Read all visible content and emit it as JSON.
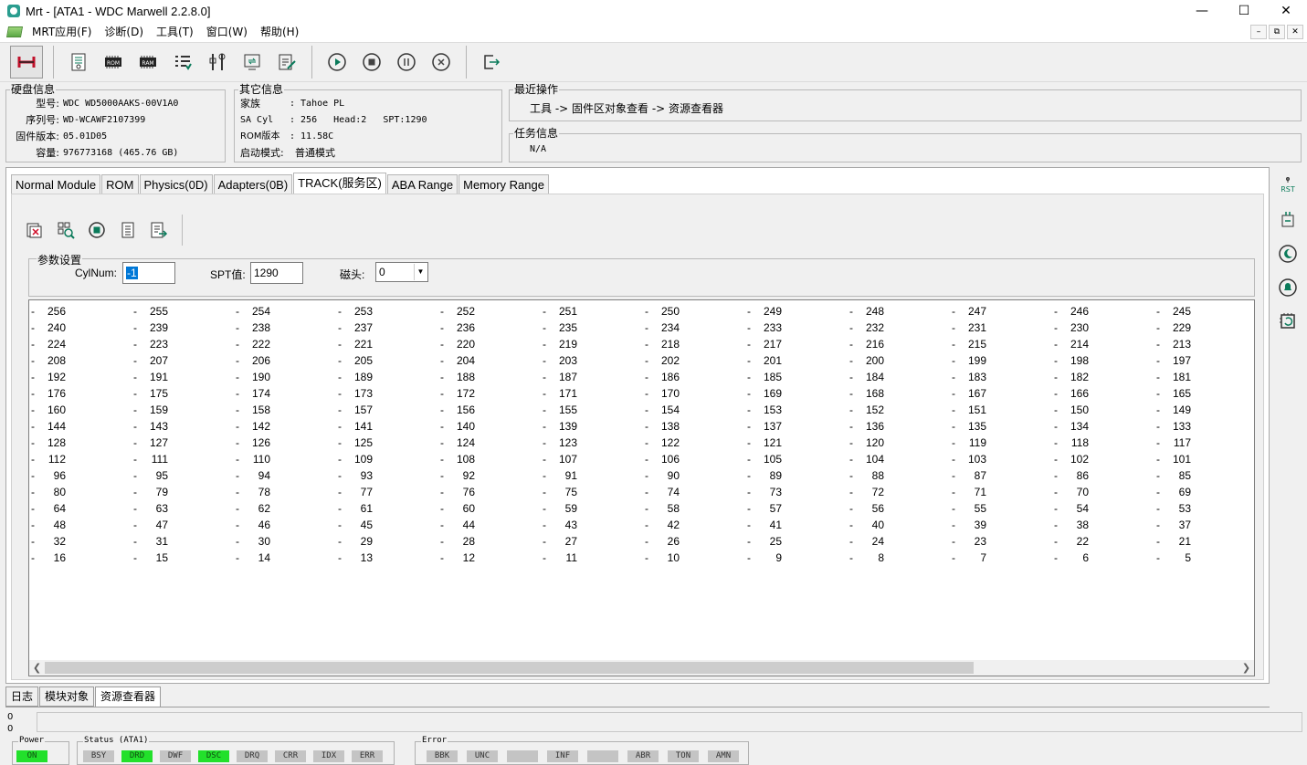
{
  "window": {
    "title": "Mrt - [ATA1 - WDC Marwell 2.2.8.0]",
    "minimize": "—",
    "maximize": "☐",
    "close": "✕"
  },
  "menu": [
    "MRT应用(F)",
    "诊断(D)",
    "工具(T)",
    "窗口(W)",
    "帮助(H)"
  ],
  "mdi_buttons": [
    "–",
    "⧉",
    "✕"
  ],
  "disk_info": {
    "legend": "硬盘信息",
    "model_label": "型号:",
    "model": "WDC WD5000AAKS-00V1A0",
    "serial_label": "序列号:",
    "serial": "WD-WCAWF2107399",
    "firmware_label": "固件版本:",
    "firmware": "05.01D05",
    "capacity_label": "容量:",
    "capacity": "976773168 (465.76 GB)"
  },
  "other_info": {
    "legend": "其它信息",
    "family_label": "家族",
    "family": ": Tahoe PL",
    "sa_label": "SA Cyl",
    "sa": ": 256   Head:2   SPT:1290",
    "rom_label": "ROM版本",
    "rom": ": 11.58C",
    "boot_label": "启动模式:",
    "boot": "普通模式"
  },
  "recent_ops": {
    "legend": "最近操作",
    "text": "工具 -> 固件区对象查看 -> 资源查看器"
  },
  "task_info": {
    "legend": "任务信息",
    "text": "N/A"
  },
  "tabs": [
    "Normal Module",
    "ROM",
    "Physics(0D)",
    "Adapters(0B)",
    "TRACK(服务区)",
    "ABA Range",
    "Memory Range"
  ],
  "active_tab": "TRACK(服务区)",
  "params": {
    "legend": "参数设置",
    "cyl_label": "CylNum:",
    "cyl_value": "-1",
    "spt_label": "SPT值:",
    "spt_value": "1290",
    "head_label": "磁头:",
    "head_value": "0"
  },
  "grid": {
    "dash": "-",
    "rows": [
      [
        256,
        255,
        254,
        253,
        252,
        251,
        250,
        249,
        248,
        247,
        246,
        245
      ],
      [
        240,
        239,
        238,
        237,
        236,
        235,
        234,
        233,
        232,
        231,
        230,
        229
      ],
      [
        224,
        223,
        222,
        221,
        220,
        219,
        218,
        217,
        216,
        215,
        214,
        213
      ],
      [
        208,
        207,
        206,
        205,
        204,
        203,
        202,
        201,
        200,
        199,
        198,
        197
      ],
      [
        192,
        191,
        190,
        189,
        188,
        187,
        186,
        185,
        184,
        183,
        182,
        181
      ],
      [
        176,
        175,
        174,
        173,
        172,
        171,
        170,
        169,
        168,
        167,
        166,
        165
      ],
      [
        160,
        159,
        158,
        157,
        156,
        155,
        154,
        153,
        152,
        151,
        150,
        149
      ],
      [
        144,
        143,
        142,
        141,
        140,
        139,
        138,
        137,
        136,
        135,
        134,
        133
      ],
      [
        128,
        127,
        126,
        125,
        124,
        123,
        122,
        121,
        120,
        119,
        118,
        117
      ],
      [
        112,
        111,
        110,
        109,
        108,
        107,
        106,
        105,
        104,
        103,
        102,
        101
      ],
      [
        96,
        95,
        94,
        93,
        92,
        91,
        90,
        89,
        88,
        87,
        86,
        85
      ],
      [
        80,
        79,
        78,
        77,
        76,
        75,
        74,
        73,
        72,
        71,
        70,
        69
      ],
      [
        64,
        63,
        62,
        61,
        60,
        59,
        58,
        57,
        56,
        55,
        54,
        53
      ],
      [
        48,
        47,
        46,
        45,
        44,
        43,
        42,
        41,
        40,
        39,
        38,
        37
      ],
      [
        32,
        31,
        30,
        29,
        28,
        27,
        26,
        25,
        24,
        23,
        22,
        21
      ],
      [
        16,
        15,
        14,
        13,
        12,
        11,
        10,
        9,
        8,
        7,
        6,
        5
      ]
    ]
  },
  "side_labels": {
    "rst": "RST"
  },
  "bottom_tabs": [
    "日志",
    "模块对象",
    "资源查看器"
  ],
  "active_bottom_tab": "资源查看器",
  "progress": {
    "top": "0",
    "bottom": "0"
  },
  "power": {
    "legend": "Power",
    "leds": [
      {
        "label": "ON",
        "on": true
      }
    ]
  },
  "status": {
    "legend": "Status (ATA1)",
    "leds": [
      {
        "label": "BSY",
        "on": false
      },
      {
        "label": "DRD",
        "on": true
      },
      {
        "label": "DWF",
        "on": false
      },
      {
        "label": "DSC",
        "on": true
      },
      {
        "label": "DRQ",
        "on": false
      },
      {
        "label": "CRR",
        "on": false
      },
      {
        "label": "IDX",
        "on": false
      },
      {
        "label": "ERR",
        "on": false
      }
    ]
  },
  "error": {
    "legend": "Error",
    "leds": [
      {
        "label": "BBK",
        "on": false
      },
      {
        "label": "UNC",
        "on": false
      },
      {
        "label": "",
        "on": false
      },
      {
        "label": "INF",
        "on": false
      },
      {
        "label": "",
        "on": false
      },
      {
        "label": "ABR",
        "on": false
      },
      {
        "label": "TON",
        "on": false
      },
      {
        "label": "AMN",
        "on": false
      }
    ]
  },
  "colors": {
    "led_on": "#22e02b",
    "led_off": "#c4c4c4",
    "selection": "#0078d7"
  }
}
